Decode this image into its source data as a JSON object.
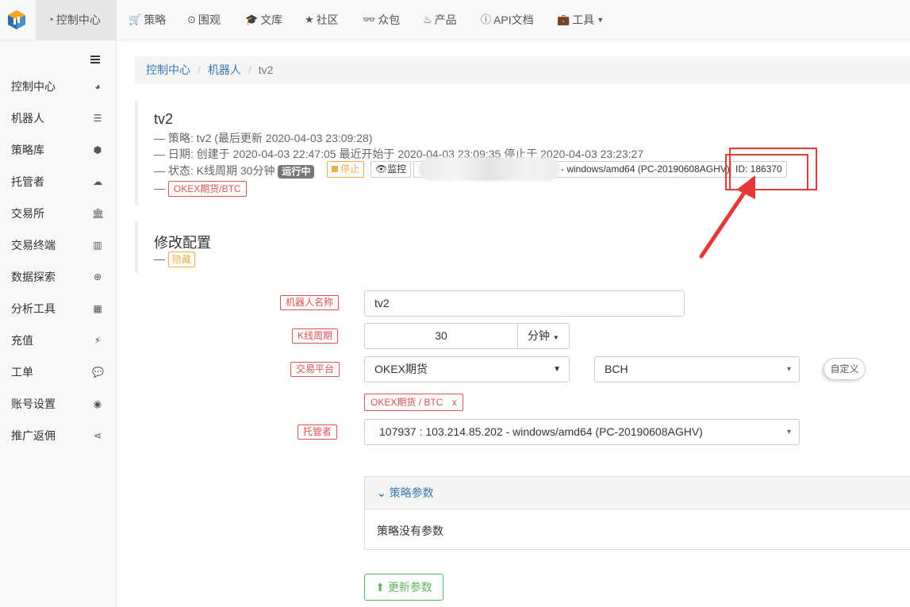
{
  "nav": {
    "items": [
      {
        "label": "控制中心",
        "icon": "dashboard-icon"
      },
      {
        "label": "策略",
        "icon": "cart-icon"
      },
      {
        "label": "围观",
        "icon": "play-circle-icon"
      },
      {
        "label": "文库",
        "icon": "graduation-cap-icon"
      },
      {
        "label": "社区",
        "icon": "star-icon"
      },
      {
        "label": "众包",
        "icon": "glasses-icon"
      },
      {
        "label": "产品",
        "icon": "fire-icon"
      },
      {
        "label": "API文档",
        "icon": "info-circle-icon"
      },
      {
        "label": "工具",
        "icon": "briefcase-icon"
      }
    ]
  },
  "sidebar": {
    "items": [
      {
        "label": "控制中心",
        "icon": "dashboard-icon"
      },
      {
        "label": "机器人",
        "icon": "list-icon"
      },
      {
        "label": "策略库",
        "icon": "cube-icon"
      },
      {
        "label": "托管者",
        "icon": "cloud-icon"
      },
      {
        "label": "交易所",
        "icon": "bank-icon"
      },
      {
        "label": "交易终端",
        "icon": "bar-chart-icon"
      },
      {
        "label": "数据探索",
        "icon": "zoom-icon"
      },
      {
        "label": "分析工具",
        "icon": "calculator-icon"
      },
      {
        "label": "充值",
        "icon": "plug-icon"
      },
      {
        "label": "工单",
        "icon": "comment-icon"
      },
      {
        "label": "账号设置",
        "icon": "user-circle-icon"
      },
      {
        "label": "推广返佣",
        "icon": "share-icon"
      }
    ]
  },
  "breadcrumb": {
    "home": "控制中心",
    "section": "机器人",
    "current": "tv2"
  },
  "robot": {
    "name": "tv2",
    "strategy_line": "— 策略: tv2  (最后更新 2020-04-03 23:09:28)",
    "date_line": "— 日期: 创建于 2020-04-03 22:47:05 最近开始于 2020-04-03 23:09:35 停止于 2020-04-03 23:23:27",
    "status_prefix": "— 状态: K线周期 30分钟",
    "status_badge": "运行中",
    "stop_label": "停止",
    "monitor_label": "监控",
    "host_text": "- windows/amd64 (PC-20190608AGHV)",
    "id_text": "ID: 186370",
    "dash": "—",
    "exchange_tag": "OKEX期货/BTC"
  },
  "config": {
    "title": "修改配置",
    "hide_label": "隐藏",
    "name_label": "机器人名称",
    "name_value": "tv2",
    "period_label": "K线周期",
    "period_value": "30",
    "period_unit": "分钟",
    "platform_label": "交易平台",
    "platform_value": "OKEX期货",
    "coin_value": "BCH",
    "custom_label": "自定义",
    "pair_tag": "OKEX期货 / BTC",
    "pair_remove": "x",
    "host_label": "托管者",
    "host_value": "107937 : 103.214.85.202 - windows/amd64 (PC-20190608AGHV)",
    "params_title": "策略参数",
    "params_empty": "策略没有参数",
    "update_label": "更新参数"
  },
  "colors": {
    "danger": "#d9534f",
    "warning": "#f0ad4e",
    "success": "#5cb85c",
    "link": "#337ab7",
    "annotation": "#e53935"
  }
}
